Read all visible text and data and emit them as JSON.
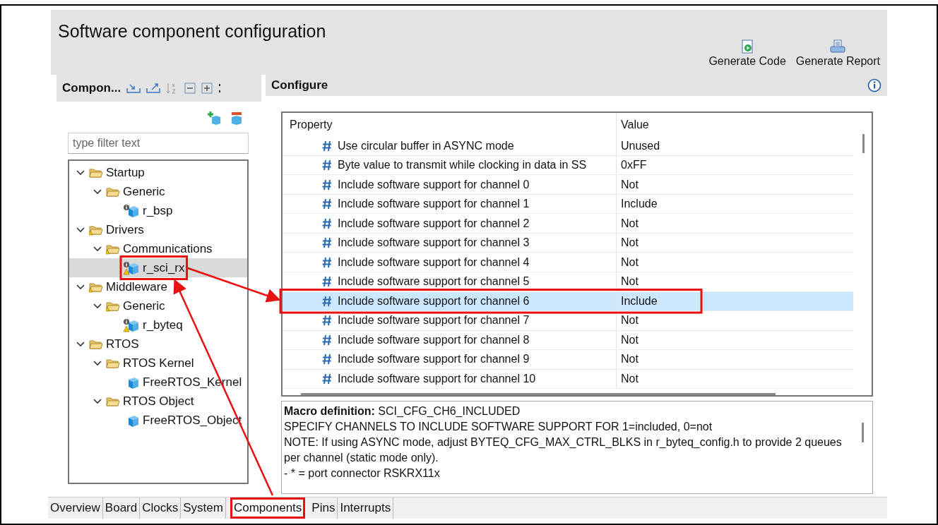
{
  "header": {
    "title": "Software component configuration",
    "actions": [
      {
        "label": "Generate Code",
        "kind": "code"
      },
      {
        "label": "Generate Report",
        "kind": "report"
      }
    ]
  },
  "components_pane": {
    "title": "Compon...",
    "filter": {
      "placeholder": "type filter text"
    },
    "tree": [
      {
        "label": "Startup",
        "kind": "folder",
        "expanded": true,
        "warning": false,
        "selected": false,
        "highlighted": false,
        "children": [
          {
            "label": "Generic",
            "kind": "folder",
            "expanded": true,
            "warning": false,
            "selected": false,
            "highlighted": false,
            "children": [
              {
                "label": "r_bsp",
                "kind": "component",
                "configurable": true,
                "warning": false,
                "selected": false,
                "highlighted": false
              }
            ]
          }
        ]
      },
      {
        "label": "Drivers",
        "kind": "folder",
        "expanded": true,
        "warning": true,
        "selected": false,
        "highlighted": false,
        "children": [
          {
            "label": "Communications",
            "kind": "folder",
            "expanded": true,
            "warning": true,
            "selected": false,
            "highlighted": false,
            "children": [
              {
                "label": "r_sci_rx",
                "kind": "component",
                "configurable": true,
                "warning": true,
                "selected": true,
                "highlighted": true
              }
            ]
          }
        ]
      },
      {
        "label": "Middleware",
        "kind": "folder",
        "expanded": true,
        "warning": true,
        "selected": false,
        "highlighted": false,
        "children": [
          {
            "label": "Generic",
            "kind": "folder",
            "expanded": true,
            "warning": true,
            "selected": false,
            "highlighted": false,
            "children": [
              {
                "label": "r_byteq",
                "kind": "component",
                "configurable": true,
                "warning": true,
                "selected": false,
                "highlighted": false
              }
            ]
          }
        ]
      },
      {
        "label": "RTOS",
        "kind": "folder",
        "expanded": true,
        "warning": false,
        "selected": false,
        "highlighted": false,
        "children": [
          {
            "label": "RTOS Kernel",
            "kind": "folder",
            "expanded": true,
            "warning": false,
            "selected": false,
            "highlighted": false,
            "children": [
              {
                "label": "FreeRTOS_Kernel",
                "kind": "component",
                "configurable": false,
                "warning": false,
                "selected": false,
                "highlighted": false
              }
            ]
          },
          {
            "label": "RTOS Object",
            "kind": "folder",
            "expanded": true,
            "warning": false,
            "selected": false,
            "highlighted": false,
            "children": [
              {
                "label": "FreeRTOS_Object",
                "kind": "component",
                "configurable": false,
                "warning": false,
                "selected": false,
                "highlighted": false
              }
            ]
          }
        ]
      }
    ]
  },
  "configure_pane": {
    "title": "Configure",
    "table": {
      "columns": [
        "Property",
        "Value"
      ],
      "rows": [
        {
          "property": "Use circular buffer in ASYNC mode",
          "value": "Unused",
          "selected": false,
          "highlighted": false
        },
        {
          "property": "Byte value to transmit while clocking in data in SS",
          "value": "0xFF",
          "selected": false,
          "highlighted": false
        },
        {
          "property": "Include software support for channel 0",
          "value": "Not",
          "selected": false,
          "highlighted": false
        },
        {
          "property": "Include software support for channel 1",
          "value": "Include",
          "selected": false,
          "highlighted": false
        },
        {
          "property": "Include software support for channel 2",
          "value": "Not",
          "selected": false,
          "highlighted": false
        },
        {
          "property": "Include software support for channel 3",
          "value": "Not",
          "selected": false,
          "highlighted": false
        },
        {
          "property": "Include software support for channel 4",
          "value": "Not",
          "selected": false,
          "highlighted": false
        },
        {
          "property": "Include software support for channel 5",
          "value": "Not",
          "selected": false,
          "highlighted": false
        },
        {
          "property": "Include software support for channel 6",
          "value": "Include",
          "selected": true,
          "highlighted": true
        },
        {
          "property": "Include software support for channel 7",
          "value": "Not",
          "selected": false,
          "highlighted": false
        },
        {
          "property": "Include software support for channel 8",
          "value": "Not",
          "selected": false,
          "highlighted": false
        },
        {
          "property": "Include software support for channel 9",
          "value": "Not",
          "selected": false,
          "highlighted": false
        },
        {
          "property": "Include software support for channel 10",
          "value": "Not",
          "selected": false,
          "highlighted": false
        }
      ]
    },
    "description": {
      "macro": "**Macro definition:** SCI_CFG_CH6_INCLUDED",
      "lines": [
        "SPECIFY CHANNELS TO INCLUDE SOFTWARE SUPPORT FOR 1=included, 0=not",
        "NOTE: If using ASYNC mode, adjust BYTEQ_CFG_MAX_CTRL_BLKS in r_byteq_config.h to provide 2 queues per channel (static mode only).",
        "- * = port connector RSKRX11x"
      ]
    }
  },
  "tabs": [
    {
      "label": "Overview",
      "selected": false,
      "highlighted": false
    },
    {
      "label": "Board",
      "selected": false,
      "highlighted": false
    },
    {
      "label": "Clocks",
      "selected": false,
      "highlighted": false
    },
    {
      "label": "System",
      "selected": false,
      "highlighted": false
    },
    {
      "label": "Components",
      "selected": true,
      "highlighted": true
    },
    {
      "label": "Pins",
      "selected": false,
      "highlighted": false
    },
    {
      "label": "Interrupts",
      "selected": false,
      "highlighted": false
    }
  ]
}
